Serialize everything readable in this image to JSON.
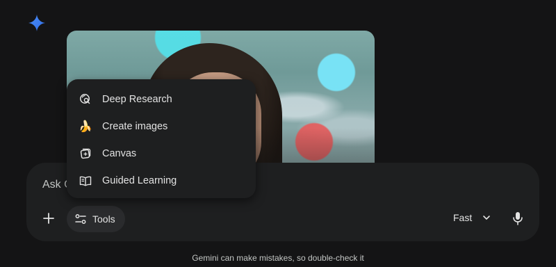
{
  "composer": {
    "placeholder_visible_text": "Ask G"
  },
  "toolbar": {
    "tools_label": "Tools",
    "model_label": "Fast",
    "add_icon": "plus-icon",
    "mic_icon": "mic-icon"
  },
  "tools_menu": {
    "items": [
      {
        "label": "Deep Research",
        "icon": "deep-research-icon"
      },
      {
        "label": "Create images",
        "icon": "banana-icon",
        "glyph": "🍌"
      },
      {
        "label": "Canvas",
        "icon": "canvas-icon"
      },
      {
        "label": "Guided Learning",
        "icon": "book-icon"
      }
    ]
  },
  "footer": {
    "disclaimer": "Gemini can make mistakes, so double-check it"
  },
  "colors": {
    "background": "#141415",
    "surface": "#1e1f20",
    "chip": "#2a2b2d",
    "text": "#e3e3e3",
    "muted_text": "#c4c7c5",
    "brand_star": "#4c8df6"
  }
}
